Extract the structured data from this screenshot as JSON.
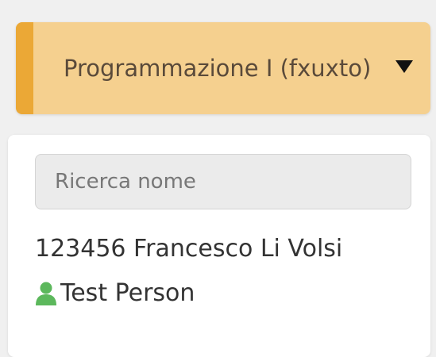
{
  "course_selector": {
    "label": "Programmazione I (fxuxto)",
    "accent_color": "#eba836",
    "background_color": "#f5d08f",
    "caret_icon": "caret-down-icon"
  },
  "search": {
    "placeholder": "Ricerca nome",
    "value": ""
  },
  "students": [
    {
      "label": "123456 Francesco Li Volsi"
    },
    {
      "label": "Test Person",
      "icon": "user-icon",
      "icon_color": "#5cb85c"
    }
  ]
}
